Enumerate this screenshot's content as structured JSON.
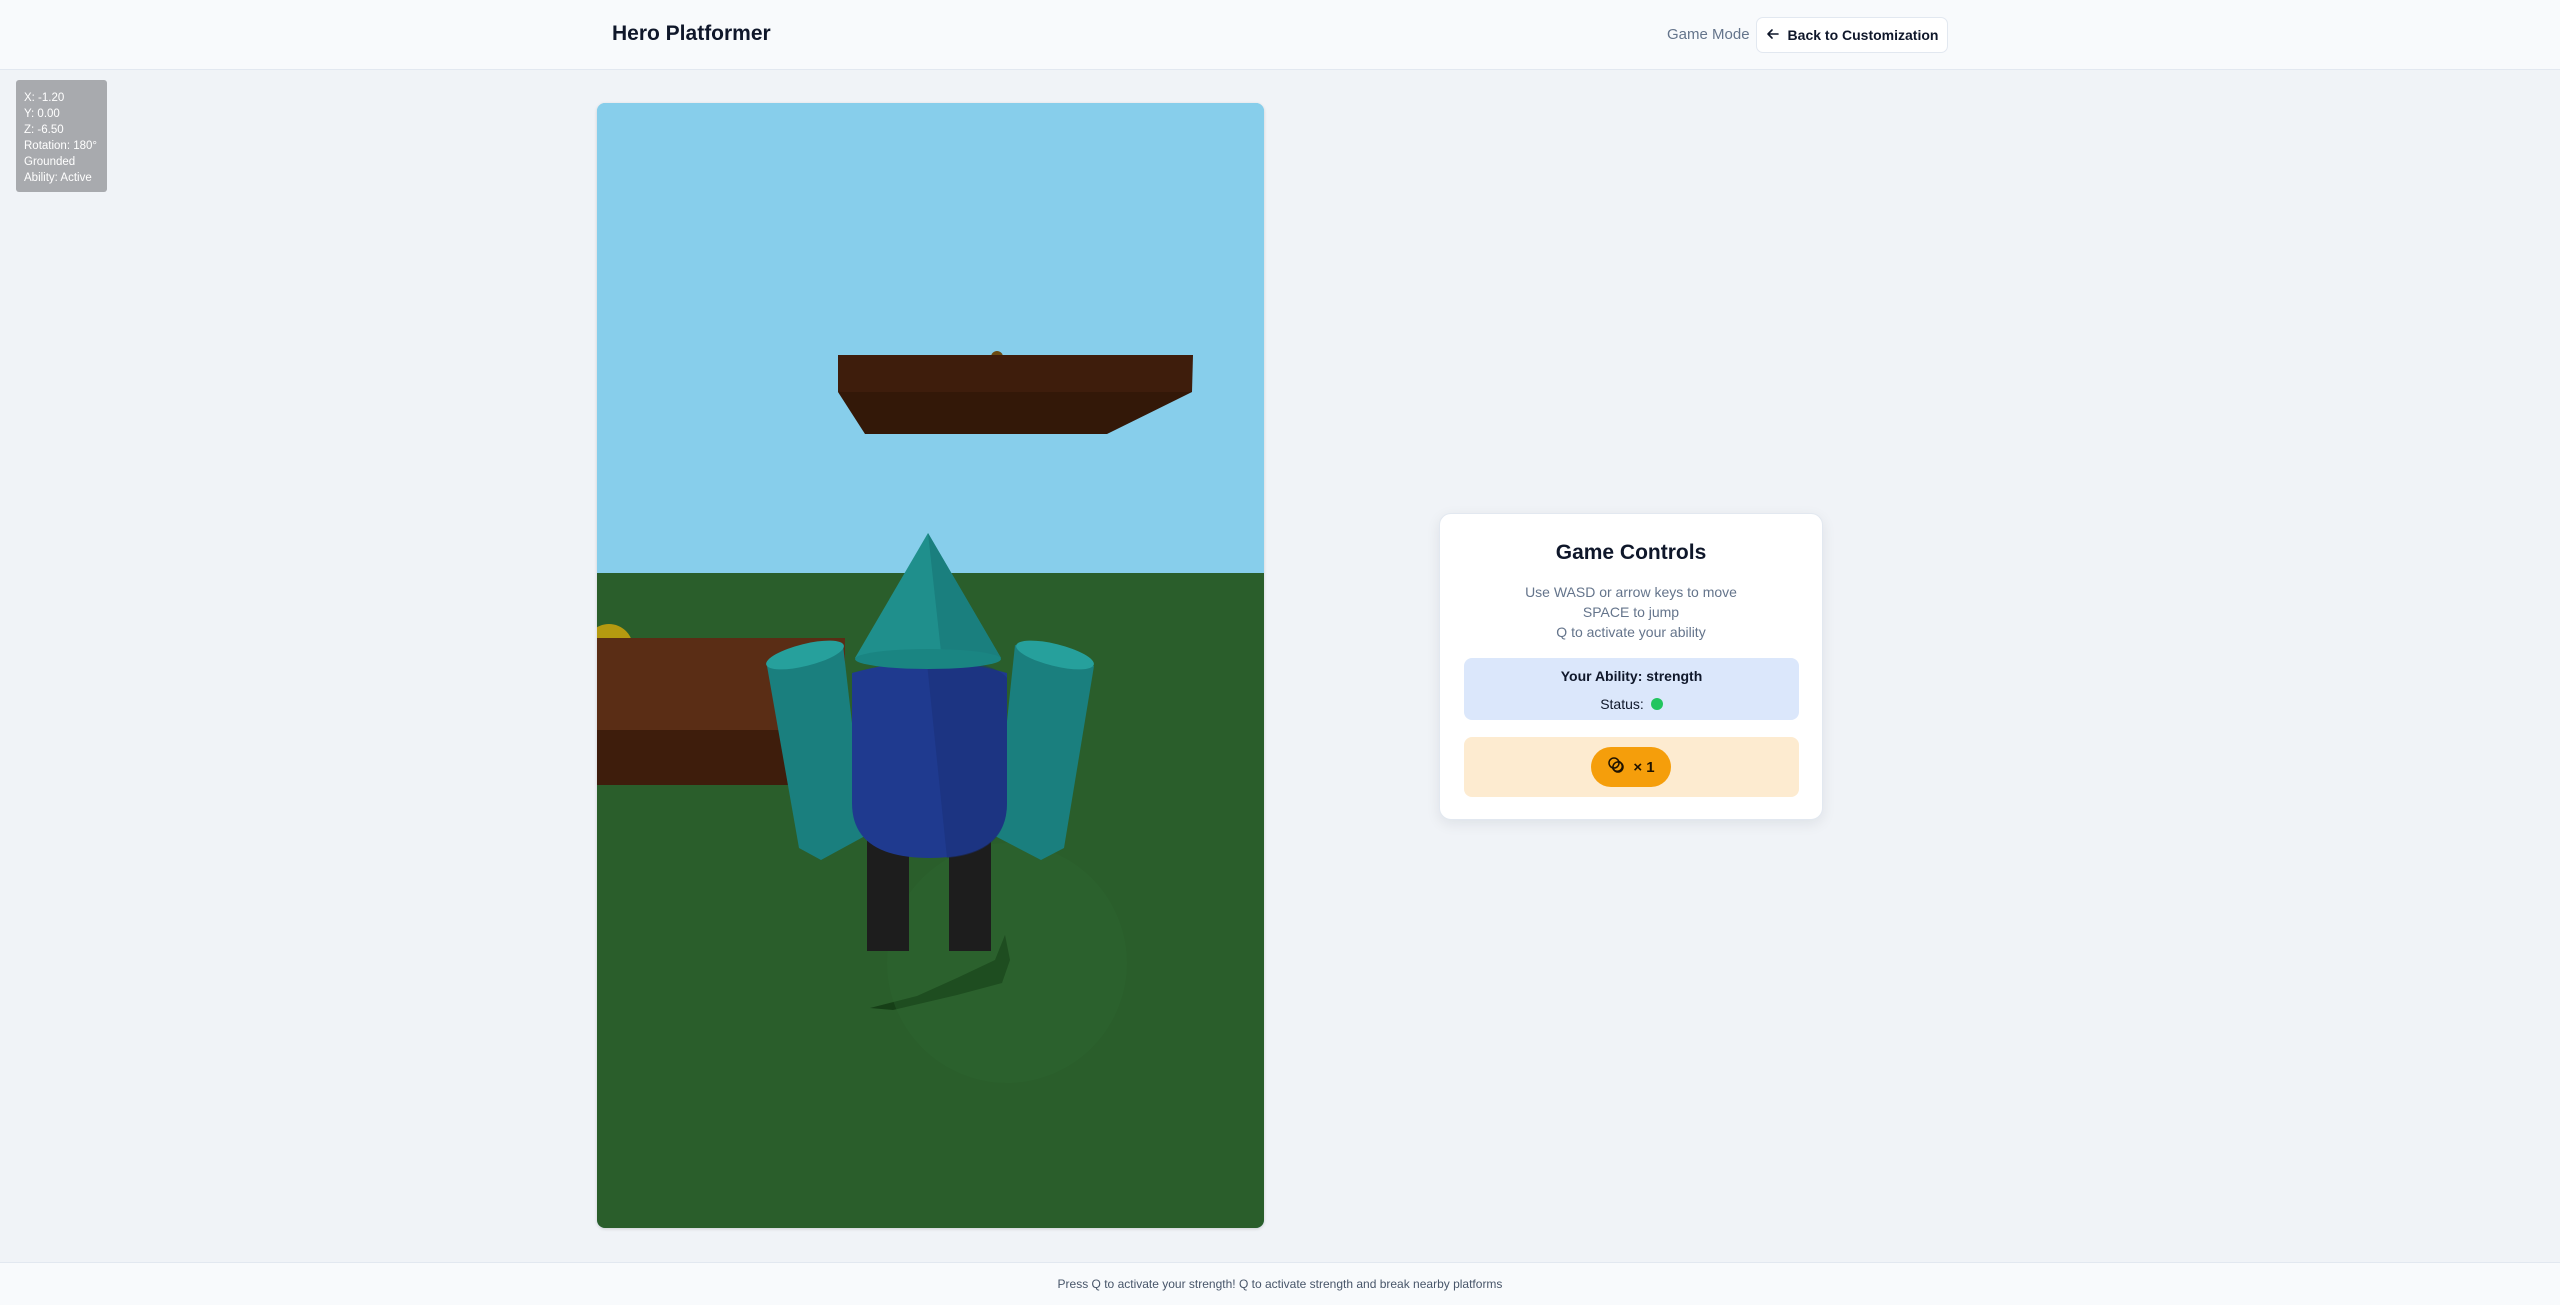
{
  "header": {
    "title": "Hero Platformer",
    "mode_label": "Game Mode",
    "back_button_label": "Back to Customization"
  },
  "debug": {
    "lines": [
      "X: -1.20",
      "Y: 0.00",
      "Z: -6.50",
      "Rotation: 180°",
      "Grounded",
      "Ability: Active"
    ]
  },
  "scene": {
    "colors": {
      "sky": "#87ceeb",
      "ground": "#2a5e2b",
      "platform_top": "#5a2d15",
      "platform_side": "#3e1d0c",
      "hero_cone": "#1f8f8c",
      "hero_body": "#1f3a8f",
      "hero_legs": "#1d1d1d",
      "coin": "#b59a10"
    }
  },
  "controls": {
    "title": "Game Controls",
    "instructions": [
      "Use WASD or arrow keys to move",
      "SPACE to jump",
      "Q to activate your ability"
    ],
    "ability_label": "Your Ability: strength",
    "status_label": "Status:",
    "status_color": "#22c55e",
    "coin_icon": "coins-icon",
    "coin_count": "× 1"
  },
  "footer": {
    "message": "Press Q to activate your strength! Q to activate strength and break nearby platforms"
  }
}
